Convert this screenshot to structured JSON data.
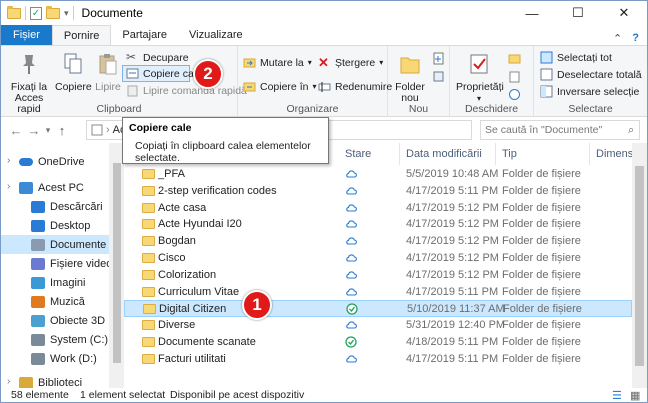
{
  "window": {
    "title": "Documente",
    "controls": [
      "minimize-icon",
      "maximize-icon",
      "close-icon"
    ]
  },
  "tabs": [
    "Fișier",
    "Pornire",
    "Partajare",
    "Vizualizare"
  ],
  "ribbon": {
    "clipboard": {
      "pin": "Fixați la Acces rapid",
      "copy": "Copiere",
      "paste": "Lipire",
      "cut": "Decupare",
      "copy_path": "Copiere cale",
      "paste_shortcut": "Lipire comandă rapidă",
      "label": "Clipboard"
    },
    "organize": {
      "move_to": "Mutare la",
      "copy_to": "Copiere în",
      "delete": "Ștergere",
      "rename": "Redenumire",
      "label": "Organizare"
    },
    "new": {
      "new_folder": "Folder nou",
      "label": "Nou"
    },
    "open": {
      "properties": "Proprietăți",
      "label": "Deschidere"
    },
    "select": {
      "select_all": "Selectați tot",
      "select_none": "Deselectare totală",
      "invert": "Inversare selecție",
      "label": "Selectare"
    }
  },
  "navbar": {
    "address": "Ac",
    "search_placeholder": "Se caută în \"Documente\""
  },
  "tooltip": {
    "title": "Copiere cale",
    "body": "Copiați în clipboard calea elementelor selectate."
  },
  "nav": [
    {
      "label": "OneDrive",
      "icon": "cloud-icon"
    },
    {
      "label": "Acest PC",
      "icon": "computer-icon"
    },
    {
      "label": "Descărcări",
      "icon": "download-icon"
    },
    {
      "label": "Desktop",
      "icon": "desktop-icon"
    },
    {
      "label": "Documente",
      "icon": "documents-icon"
    },
    {
      "label": "Fișiere video",
      "icon": "video-icon"
    },
    {
      "label": "Imagini",
      "icon": "pictures-icon"
    },
    {
      "label": "Muzică",
      "icon": "music-icon"
    },
    {
      "label": "Obiecte 3D",
      "icon": "cube-icon"
    },
    {
      "label": "System (C:)",
      "icon": "drive-icon"
    },
    {
      "label": "Work (D:)",
      "icon": "drive-icon"
    },
    {
      "label": "Biblioteci",
      "icon": "library-icon"
    }
  ],
  "columns": [
    "Stare",
    "Data modificării",
    "Tip",
    "Dimensiu"
  ],
  "files": [
    {
      "name": "_PFA",
      "state": "cloud",
      "date": "5/5/2019 10:48 AM",
      "type": "Folder de fișiere"
    },
    {
      "name": "2-step verification codes",
      "state": "cloud",
      "date": "4/17/2019 5:11 PM",
      "type": "Folder de fișiere"
    },
    {
      "name": "Acte casa",
      "state": "cloud",
      "date": "4/17/2019 5:12 PM",
      "type": "Folder de fișiere"
    },
    {
      "name": "Acte Hyundai I20",
      "state": "cloud",
      "date": "4/17/2019 5:12 PM",
      "type": "Folder de fișiere"
    },
    {
      "name": "Bogdan",
      "state": "cloud",
      "date": "4/17/2019 5:12 PM",
      "type": "Folder de fișiere"
    },
    {
      "name": "Cisco",
      "state": "cloud",
      "date": "4/17/2019 5:12 PM",
      "type": "Folder de fișiere"
    },
    {
      "name": "Colorization",
      "state": "cloud",
      "date": "4/17/2019 5:12 PM",
      "type": "Folder de fișiere"
    },
    {
      "name": "Curriculum Vitae",
      "state": "cloud",
      "date": "4/17/2019 5:11 PM",
      "type": "Folder de fișiere"
    },
    {
      "name": "Digital Citizen",
      "state": "synced",
      "date": "5/10/2019 11:37 AM",
      "type": "Folder de fișiere"
    },
    {
      "name": "Diverse",
      "state": "cloud",
      "date": "5/31/2019 12:40 PM",
      "type": "Folder de fișiere"
    },
    {
      "name": "Documente scanate",
      "state": "synced",
      "date": "4/18/2019 5:11 PM",
      "type": "Folder de fișiere"
    },
    {
      "name": "Facturi utilitati",
      "state": "cloud",
      "date": "4/17/2019 5:11 PM",
      "type": "Folder de fișiere"
    }
  ],
  "selected_row": 8,
  "status": {
    "count": "58 elemente",
    "selected": "1 element selectat",
    "availability": "Disponibil pe acest dispozitiv"
  },
  "badges": [
    "1",
    "2"
  ],
  "colors": {
    "accent": "#1979ca",
    "selection": "#cce8ff",
    "badge": "#e01919",
    "cloud": "#2a7bd6",
    "synced": "#21a15a"
  }
}
